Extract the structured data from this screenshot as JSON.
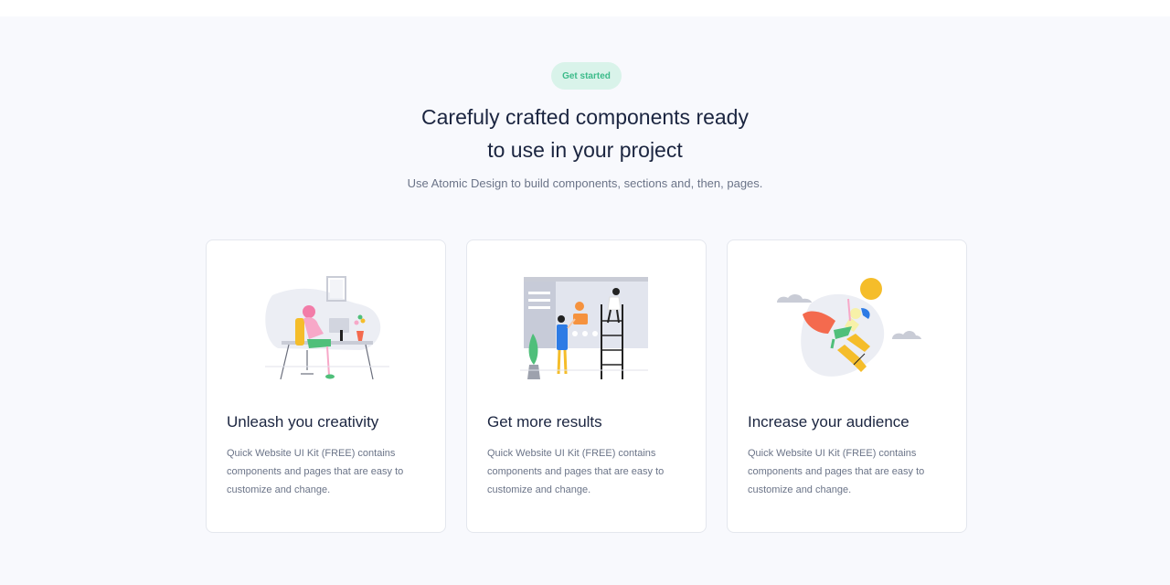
{
  "hero": {
    "badge": "Get started",
    "title_line1": "Carefuly crafted components ready",
    "title_line2": "to use in your project",
    "subtitle": "Use Atomic Design to build components, sections and, then, pages."
  },
  "cards": [
    {
      "title": "Unleash you creativity",
      "text": "Quick Website UI Kit (FREE) contains components and pages that are easy to customize and change.",
      "illustration": "woman-at-desk-illustration"
    },
    {
      "title": "Get more results",
      "text": "Quick Website UI Kit (FREE) contains components and pages that are easy to customize and change.",
      "illustration": "team-at-board-illustration"
    },
    {
      "title": "Increase your audience",
      "text": "Quick Website UI Kit (FREE) contains components and pages that are easy to customize and change.",
      "illustration": "rocket-person-illustration"
    }
  ],
  "colors": {
    "accent_green": "#3cbb8a",
    "badge_bg": "#d9f3ea",
    "heading": "#1b2540",
    "body_text": "#6b7488",
    "section_bg": "#f8f9fd"
  }
}
